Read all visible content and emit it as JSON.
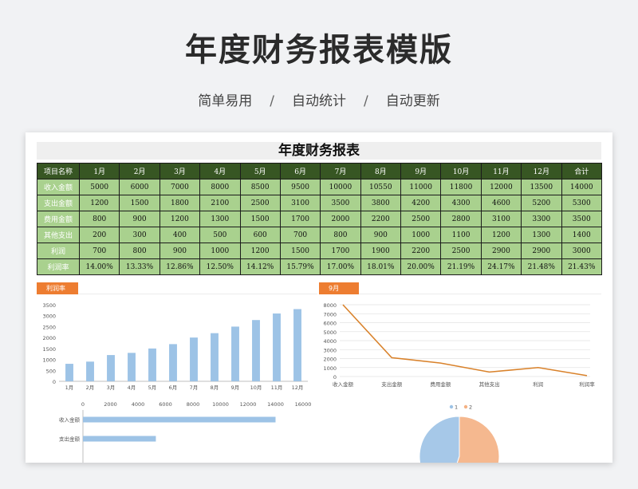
{
  "hero": {
    "title": "年度财务报表模版",
    "tag1": "简单易用",
    "tag2": "自动统计",
    "tag3": "自动更新",
    "sep": "/"
  },
  "report": {
    "title": "年度财务报表",
    "header": [
      "项目名称",
      "1月",
      "2月",
      "3月",
      "4月",
      "5月",
      "6月",
      "7月",
      "8月",
      "9月",
      "10月",
      "11月",
      "12月",
      "合计"
    ],
    "rows": [
      {
        "label": "收入金额",
        "values": [
          "5000",
          "6000",
          "7000",
          "8000",
          "8500",
          "9500",
          "10000",
          "10550",
          "11000",
          "11800",
          "12000",
          "13500",
          "14000"
        ]
      },
      {
        "label": "支出金额",
        "values": [
          "1200",
          "1500",
          "1800",
          "2100",
          "2500",
          "3100",
          "3500",
          "3800",
          "4200",
          "4300",
          "4600",
          "5200",
          "5300"
        ]
      },
      {
        "label": "费用金额",
        "values": [
          "800",
          "900",
          "1200",
          "1300",
          "1500",
          "1700",
          "2000",
          "2200",
          "2500",
          "2800",
          "3100",
          "3300",
          "3500"
        ]
      },
      {
        "label": "其他支出",
        "values": [
          "200",
          "300",
          "400",
          "500",
          "600",
          "700",
          "800",
          "900",
          "1000",
          "1100",
          "1200",
          "1300",
          "1400"
        ]
      },
      {
        "label": "利润",
        "values": [
          "700",
          "800",
          "900",
          "1000",
          "1200",
          "1500",
          "1700",
          "1900",
          "2200",
          "2500",
          "2900",
          "2900",
          "3000"
        ]
      },
      {
        "label": "利润率",
        "values": [
          "14.00%",
          "13.33%",
          "12.86%",
          "12.50%",
          "14.12%",
          "15.79%",
          "17.00%",
          "18.01%",
          "20.00%",
          "21.19%",
          "24.17%",
          "21.48%",
          "21.43%"
        ]
      }
    ]
  },
  "colors": {
    "header_bg": "#375623",
    "cell_bg": "#a9d18e",
    "tab": "#ed7d31",
    "bar": "#9dc3e6",
    "line": "#d9822b",
    "pie1": "#9dc3e6",
    "pie2": "#f4b183"
  },
  "chart_data": [
    {
      "type": "bar",
      "tab_label": "利润率",
      "categories": [
        "1月",
        "2月",
        "3月",
        "4月",
        "5月",
        "6月",
        "7月",
        "8月",
        "9月",
        "10月",
        "11月",
        "12月"
      ],
      "values": [
        800,
        900,
        1200,
        1300,
        1500,
        1700,
        2000,
        2200,
        2500,
        2800,
        3100,
        3300
      ],
      "ylim": [
        0,
        3500
      ],
      "yticks": [
        "0",
        "500",
        "1000",
        "1500",
        "2000",
        "2500",
        "3000",
        "3500"
      ],
      "grid": false
    },
    {
      "type": "line",
      "tab_label": "9月",
      "categories": [
        "收入金额",
        "支出金额",
        "费用金额",
        "其他支出",
        "利润",
        "利润率"
      ],
      "values": [
        8000,
        2100,
        1500,
        500,
        1000,
        100
      ],
      "ylim": [
        0,
        8000
      ],
      "yticks": [
        "0",
        "1000",
        "2000",
        "3000",
        "4000",
        "5000",
        "6000",
        "7000",
        "8000"
      ],
      "grid": true
    },
    {
      "type": "bar",
      "orientation": "horizontal",
      "categories": [
        "收入金额",
        "支出金额"
      ],
      "values": [
        14000,
        5300
      ],
      "xlim": [
        0,
        16000
      ],
      "xticks": [
        "0",
        "2000",
        "4000",
        "6000",
        "8000",
        "10000",
        "12000",
        "14000",
        "16000"
      ]
    },
    {
      "type": "pie",
      "legend": [
        "1",
        "2"
      ],
      "legend_position": "top",
      "values": [
        45,
        55
      ]
    }
  ]
}
